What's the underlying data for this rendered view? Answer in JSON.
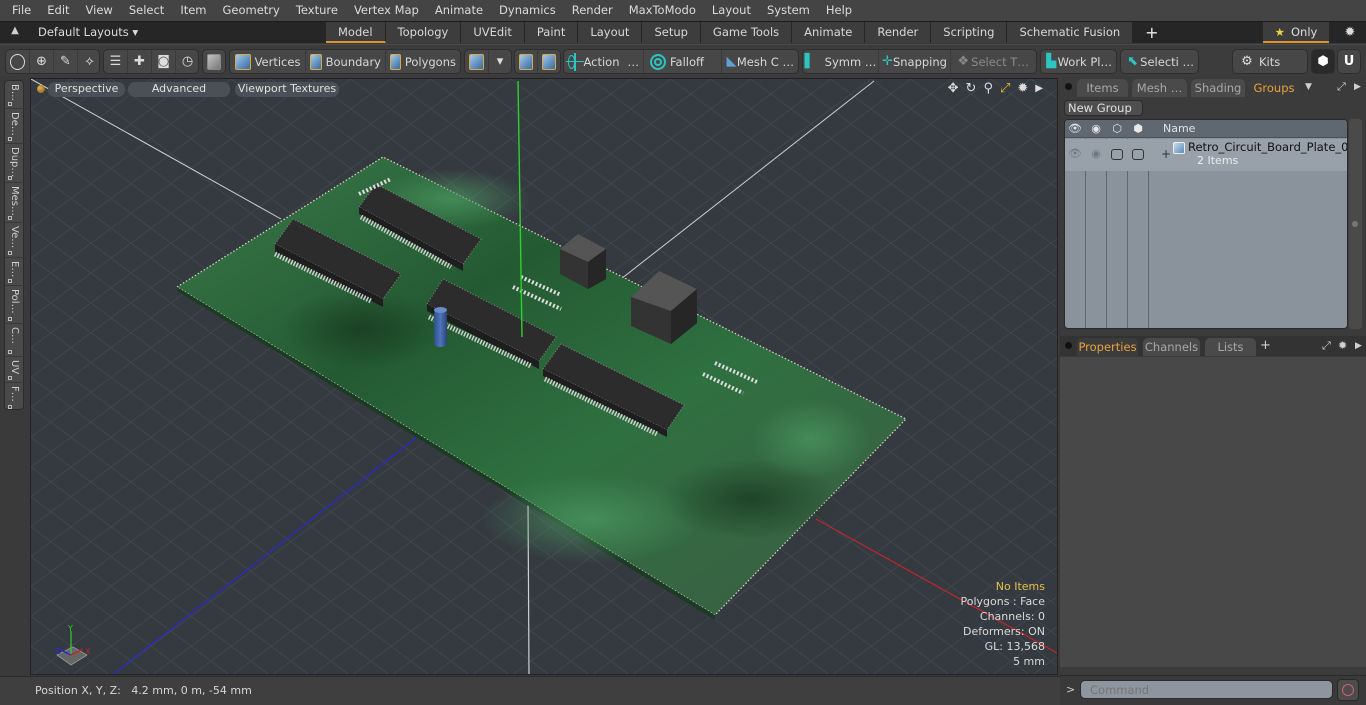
{
  "menu": [
    "File",
    "Edit",
    "View",
    "Select",
    "Item",
    "Geometry",
    "Texture",
    "Vertex Map",
    "Animate",
    "Dynamics",
    "Render",
    "MaxToModo",
    "Layout",
    "System",
    "Help"
  ],
  "layouts": {
    "label": "Default Layouts ▾",
    "tabs": [
      "Model",
      "Topology",
      "UVEdit",
      "Paint",
      "Layout",
      "Setup",
      "Game Tools",
      "Animate",
      "Render",
      "Scripting",
      "Schematic Fusion"
    ],
    "active_tab": "Model",
    "add_tab_label": "+",
    "only_label": "Only"
  },
  "toolbar": {
    "vertices": "Vertices",
    "boundary": "Boundary",
    "polygons": "Polygons",
    "action": "Action",
    "falloff": "Falloff",
    "mesh_c": "Mesh C …",
    "symm": "Symm …",
    "snapping": "Snapping",
    "select_t": "Select T…",
    "work_pl": "Work Pl…",
    "selecti": "Selecti …",
    "kits": "Kits",
    "ellipsis": "…"
  },
  "left_strip": [
    "B…",
    "De…",
    "Dup…",
    "Mes…",
    "Ve…",
    "E…",
    "Pol…",
    "C…",
    "UV",
    "F…"
  ],
  "viewport": {
    "view_mode": "Perspective",
    "shading": "Advanced",
    "textures": "Viewport Textures",
    "info": {
      "selection": "No Items",
      "polygons": "Polygons : Face",
      "channels": "Channels: 0",
      "deformers": "Deformers: ON",
      "gl": "GL: 13,568",
      "grid": "5 mm"
    },
    "axis_labels": {
      "x": "X",
      "y": "Y",
      "z": "Z"
    },
    "colors": {
      "x_axis": "#c0262c",
      "y_axis": "#2fd12f",
      "z_axis": "#2a2ad0",
      "board": "#2c6a3c"
    }
  },
  "status": {
    "position_label": "Position X, Y, Z:",
    "position_value": "4.2 mm, 0 m, -54 mm"
  },
  "groups_panel": {
    "tabs": [
      "Items",
      "Mesh …",
      "Shading",
      "Groups"
    ],
    "active_tab": "Groups",
    "new_group": "New Group",
    "column_name": "Name",
    "rows": [
      {
        "name": "Retro_Circuit_Board_Plate_0 …",
        "count": "2 Items"
      }
    ]
  },
  "properties_panel": {
    "tabs": [
      "Properties",
      "Channels",
      "Lists"
    ],
    "active_tab": "Properties",
    "add_label": "+"
  },
  "command": {
    "prompt": ">",
    "placeholder": "Command"
  },
  "accent_color": "#e0922a"
}
